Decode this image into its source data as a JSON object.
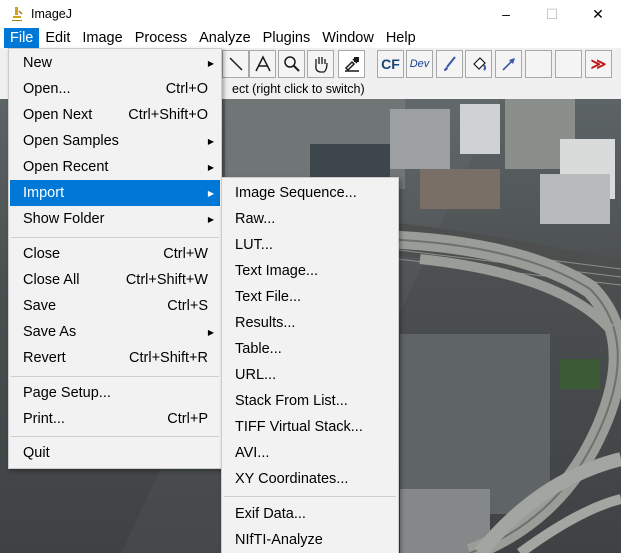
{
  "window": {
    "title": "ImageJ",
    "controls": [
      "–",
      "☐",
      "✕"
    ]
  },
  "menubar": {
    "items": [
      "File",
      "Edit",
      "Image",
      "Process",
      "Analyze",
      "Plugins",
      "Window",
      "Help"
    ],
    "active": "File"
  },
  "toolbar": {
    "tools": [
      "line-tool",
      "text-tool",
      "zoom-tool",
      "hand-tool",
      "dropper-tool",
      "cf-tool",
      "dev-tool",
      "brush-tool",
      "flood-fill-tool",
      "arrow-tool",
      "empty-slot",
      "empty-slot",
      "more-tools"
    ],
    "cf_label": "CF",
    "dev_label": "Dev",
    "more_label": "≫"
  },
  "status": {
    "text": "ect (right click to switch)"
  },
  "file_menu": {
    "items": [
      {
        "label": "New",
        "submenu": true
      },
      {
        "label": "Open...",
        "shortcut": "Ctrl+O"
      },
      {
        "label": "Open Next",
        "shortcut": "Ctrl+Shift+O"
      },
      {
        "label": "Open Samples",
        "submenu": true
      },
      {
        "label": "Open Recent",
        "submenu": true
      },
      {
        "label": "Import",
        "submenu": true,
        "highlighted": true
      },
      {
        "label": "Show Folder",
        "submenu": true
      },
      {
        "label": "Close",
        "shortcut": "Ctrl+W"
      },
      {
        "label": "Close All",
        "shortcut": "Ctrl+Shift+W"
      },
      {
        "label": "Save",
        "shortcut": "Ctrl+S"
      },
      {
        "label": "Save As",
        "submenu": true
      },
      {
        "label": "Revert",
        "shortcut": "Ctrl+Shift+R"
      },
      {
        "label": "Page Setup..."
      },
      {
        "label": "Print...",
        "shortcut": "Ctrl+P"
      },
      {
        "label": "Quit"
      }
    ]
  },
  "import_menu": {
    "items": [
      "Image Sequence...",
      "Raw...",
      "LUT...",
      "Text Image...",
      "Text File...",
      "Results...",
      "Table...",
      "URL...",
      "Stack From List...",
      "TIFF Virtual Stack...",
      "AVI...",
      "XY Coordinates...",
      "Exif Data...",
      "NIfTI-Analyze"
    ]
  },
  "colors": {
    "accent": "#0078d7",
    "menu_bg": "#f2f2f2",
    "toolbar_bg": "#f0f0f0"
  }
}
